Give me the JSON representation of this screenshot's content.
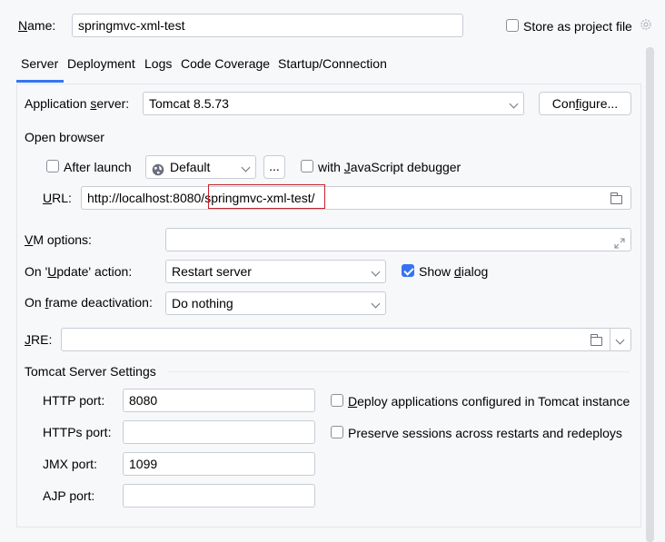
{
  "name_label": "Name:",
  "name_value": "springmvc-xml-test",
  "store_label": "Store as project file",
  "store_checked": false,
  "tabs": [
    "Server",
    "Deployment",
    "Logs",
    "Code Coverage",
    "Startup/Connection"
  ],
  "active_tab": "Server",
  "app_server": {
    "label": "Application server:",
    "value": "Tomcat 8.5.73",
    "configure_label": "Configure..."
  },
  "open_browser": {
    "section": "Open browser",
    "after_launch_label": "After launch",
    "after_launch_checked": false,
    "browser_value": "Default",
    "ellipsis_label": "...",
    "js_debugger_label": "with JavaScript debugger",
    "js_debugger_checked": false,
    "url_label": "URL:",
    "url_prefix": "http://localhost:8080/",
    "url_highlight": "springmvc-xml-test/"
  },
  "vm_options": {
    "label": "VM options:",
    "value": ""
  },
  "on_update": {
    "label": "On 'Update' action:",
    "value": "Restart server",
    "show_dialog_label": "Show dialog",
    "show_dialog_checked": true
  },
  "on_frame": {
    "label": "On frame deactivation:",
    "value": "Do nothing"
  },
  "jre": {
    "label": "JRE:",
    "value": ""
  },
  "tomcat_settings": {
    "section": "Tomcat Server Settings",
    "http_label": "HTTP port:",
    "http_value": "8080",
    "https_label": "HTTPs port:",
    "https_value": "",
    "jmx_label": "JMX port:",
    "jmx_value": "1099",
    "ajp_label": "AJP port:",
    "ajp_value": "",
    "deploy_label": "Deploy applications configured in Tomcat instance",
    "deploy_checked": false,
    "preserve_label": "Preserve sessions across restarts and redeploys",
    "preserve_checked": false
  },
  "colors": {
    "accent": "#3574f0",
    "highlight_border": "#c7202a"
  }
}
